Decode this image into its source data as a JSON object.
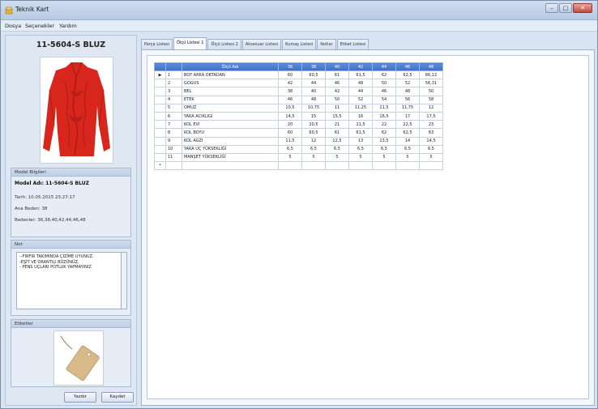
{
  "window": {
    "title": "Teknik Kart"
  },
  "menu": [
    "Dosya",
    "Seçenekler",
    "Yardım"
  ],
  "model": {
    "code_title": "11-5604-S BLUZ",
    "info_header": "Model Bilgileri",
    "model_name": "Model Adı: 11-5604-S BLUZ",
    "date": "Tarih: 10.05.2015 23:27:17",
    "base_size": "Ana Beden: 38",
    "sizes": "Bedenler: 36,38,40,42,44,46,48"
  },
  "notes": {
    "header": "Not",
    "lines": [
      "--FIRFIR TAKIMINDA ÇİZİME UYUNUZ.",
      "-EŞİT VE ORANTILI BÜZÜNÜZ.",
      "- PENS UÇLARI POTLUK YAPMAYINIZ"
    ]
  },
  "labels": {
    "header": "Etiketler"
  },
  "buttons": {
    "print": "Yazdır",
    "save": "Kaydet"
  },
  "tabs": [
    "Parça Listesi",
    "Ölçü Listesi 1",
    "Ölçü Listesi 2",
    "Aksesuar Listesi",
    "Kumaş Listesi",
    "Notlar",
    "Etiket Listesi"
  ],
  "active_tab": 1,
  "grid": {
    "name_header": "Ölçü Adı",
    "size_headers": [
      "36",
      "38",
      "40",
      "42",
      "44",
      "46",
      "48"
    ],
    "rows": [
      {
        "no": "1",
        "name": "BOY ARKA ORTADAN",
        "values": [
          "60",
          "60,5",
          "61",
          "61,5",
          "62",
          "62,5",
          "66,12"
        ]
      },
      {
        "no": "2",
        "name": "GOGUS",
        "values": [
          "42",
          "44",
          "46",
          "48",
          "50",
          "52",
          "56,31"
        ]
      },
      {
        "no": "3",
        "name": "BEL",
        "values": [
          "38",
          "40",
          "42",
          "44",
          "46",
          "48",
          "50"
        ]
      },
      {
        "no": "4",
        "name": "ETEK",
        "values": [
          "46",
          "48",
          "50",
          "52",
          "54",
          "56",
          "58"
        ]
      },
      {
        "no": "5",
        "name": "OMUZ",
        "values": [
          "10,5",
          "10,75",
          "11",
          "11,25",
          "11,5",
          "11,75",
          "12"
        ]
      },
      {
        "no": "6",
        "name": "YAKA ACIKLIGI",
        "values": [
          "14,5",
          "15",
          "15,5",
          "16",
          "16,5",
          "17",
          "17,5"
        ]
      },
      {
        "no": "7",
        "name": "KOL EVI",
        "values": [
          "20",
          "20,5",
          "21",
          "21,5",
          "22",
          "22,5",
          "23"
        ]
      },
      {
        "no": "8",
        "name": "KOL BOYU",
        "values": [
          "60",
          "60,5",
          "61",
          "61,5",
          "62",
          "62,5",
          "63"
        ]
      },
      {
        "no": "9",
        "name": "KOL AGZI",
        "values": [
          "11,5",
          "12",
          "12,5",
          "13",
          "13,5",
          "14",
          "14,5"
        ]
      },
      {
        "no": "10",
        "name": "YAKA UÇ YÜKSEKLİĞİ",
        "values": [
          "6,5",
          "6,5",
          "6,5",
          "6,5",
          "6,5",
          "6,5",
          "6,5"
        ]
      },
      {
        "no": "11",
        "name": "MANŞET YÜKSEKLİĞİ",
        "values": [
          "5",
          "5",
          "5",
          "5",
          "5",
          "5",
          "5"
        ]
      }
    ],
    "current_row_marker": "▶",
    "new_row_marker": "*"
  },
  "colors": {
    "header_blue": "#3c6fc4",
    "garment_red": "#d8261c",
    "tag_tan": "#d7b98a"
  }
}
